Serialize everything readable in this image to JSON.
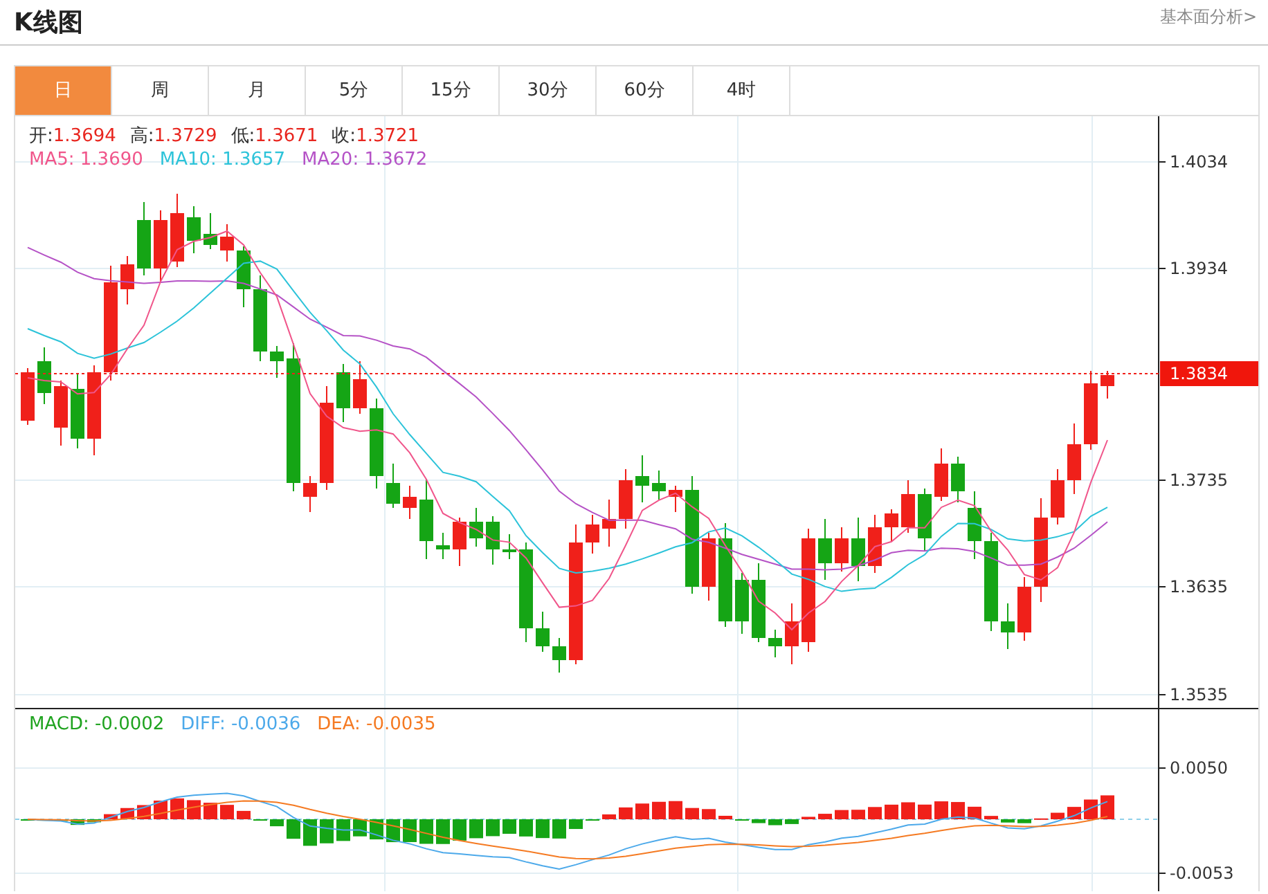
{
  "title": "K线图",
  "link": "基本面分析>",
  "tabs": [
    {
      "label": "日",
      "selected": true
    },
    {
      "label": "周",
      "selected": false
    },
    {
      "label": "月",
      "selected": false
    },
    {
      "label": "5分",
      "selected": false
    },
    {
      "label": "15分",
      "selected": false
    },
    {
      "label": "30分",
      "selected": false
    },
    {
      "label": "60分",
      "selected": false
    },
    {
      "label": "4时",
      "selected": false
    }
  ],
  "ohlc_legend": [
    {
      "label": "开:",
      "value": "1.3694"
    },
    {
      "label": "高:",
      "value": "1.3729"
    },
    {
      "label": "低:",
      "value": "1.3671"
    },
    {
      "label": "收:",
      "value": "1.3721"
    }
  ],
  "ma_legend": [
    {
      "text": "MA5: 1.3690",
      "color": "#f0558a"
    },
    {
      "text": "MA10: 1.3657",
      "color": "#2cc3d9"
    },
    {
      "text": "MA20: 1.3672",
      "color": "#b552c6"
    }
  ],
  "price_axis": {
    "ticks": [
      "1.4034",
      "1.3934",
      "1.3735",
      "1.3635",
      "1.3535"
    ],
    "current_price": "1.3834"
  },
  "macd_legend": [
    {
      "text": "MACD: -0.0002",
      "color": "#1fa31f"
    },
    {
      "text": "DIFF: -0.0036",
      "color": "#4ca9ea"
    },
    {
      "text": "DEA: -0.0035",
      "color": "#f57a22"
    }
  ],
  "macd_axis": {
    "ticks": [
      "0.0050",
      "-0.0053"
    ]
  }
}
